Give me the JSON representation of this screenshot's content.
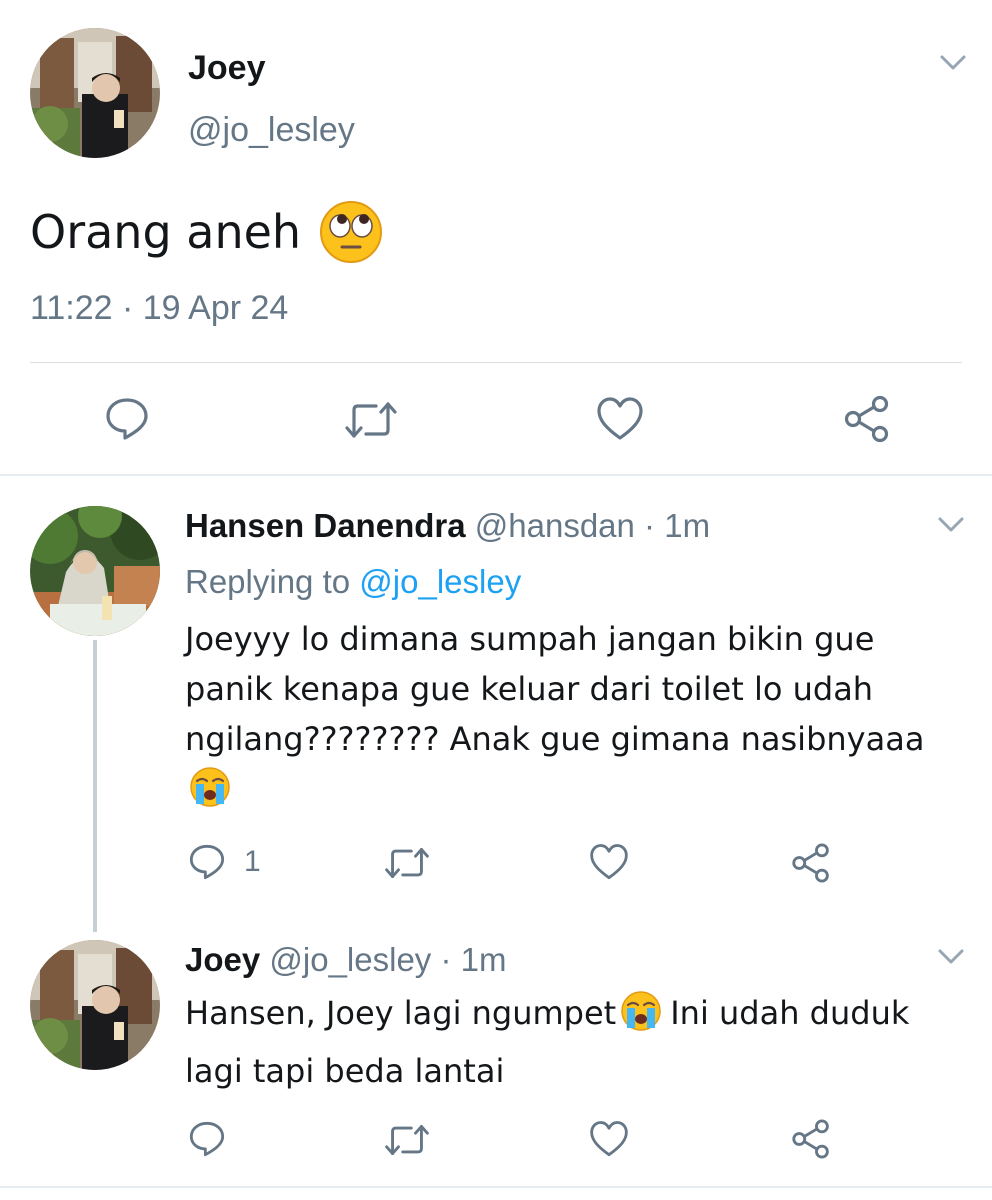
{
  "main_tweet": {
    "name": "Joey",
    "handle": "@jo_lesley",
    "text": "Orang aneh",
    "emoji": "eye-roll-emoji",
    "timestamp": "11:22 · 19 Apr 24"
  },
  "replies": [
    {
      "name": "Hansen Danendra",
      "meta": "@hansdan · 1m",
      "replying_prefix": "Replying to",
      "replying_handle": "@jo_lesley",
      "text": "Joeyyy lo dimana sumpah jangan bikin gue panik kenapa gue keluar dari toilet lo udah ngilang???????? Anak gue gimana nasibnyaaa",
      "emoji": "loudly-crying-emoji",
      "reply_count": "1"
    },
    {
      "name": "Joey",
      "meta": "@jo_lesley · 1m",
      "text_before": "Hansen, Joey lagi ngumpet",
      "emoji": "loudly-crying-emoji",
      "text_after": "Ini udah duduk lagi tapi beda lantai"
    }
  ],
  "colors": {
    "text": "#14171a",
    "secondary": "#657786",
    "link": "#1da1f2",
    "divider": "#e6ecf0",
    "thread_line": "#c4cfd6"
  }
}
